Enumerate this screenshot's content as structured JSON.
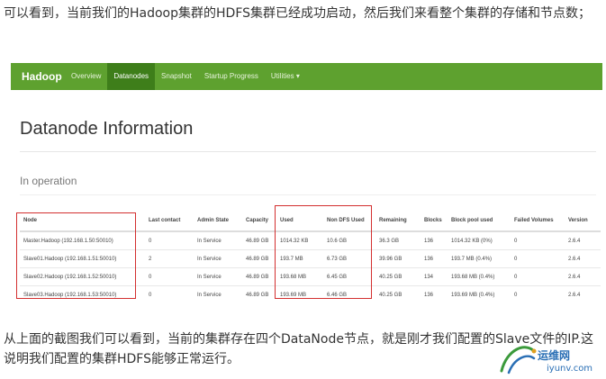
{
  "article": {
    "para1": "可以看到，当前我们的Hadoop集群的HDFS集群已经成功启动，然后我们来看整个集群的存储和节点数；",
    "para2": "从上面的截图我们可以看到，当前的集群存在四个DataNode节点，就是刚才我们配置的Slave文件的IP.这说明我们配置的集群HDFS能够正常运行。"
  },
  "navbar": {
    "brand": "Hadoop",
    "items": [
      {
        "label": "Overview"
      },
      {
        "label": "Datanodes",
        "active": true
      },
      {
        "label": "Snapshot"
      },
      {
        "label": "Startup Progress"
      },
      {
        "label": "Utilities ▾"
      }
    ],
    "bg_color": "#5ea12f",
    "active_color": "#3e7e1a"
  },
  "page": {
    "title": "Datanode Information",
    "subtitle": "In operation"
  },
  "table": {
    "headers": [
      "Node",
      "Last contact",
      "Admin State",
      "Capacity",
      "Used",
      "Non DFS Used",
      "Remaining",
      "Blocks",
      "Block pool used",
      "Failed Volumes",
      "Version"
    ],
    "rows": [
      [
        "Master.Hadoop (192.168.1.50:50010)",
        "0",
        "In Service",
        "46.89 GB",
        "1014.32 KB",
        "10.6 GB",
        "36.3 GB",
        "136",
        "1014.32 KB (0%)",
        "0",
        "2.6.4"
      ],
      [
        "Slave01.Hadoop (192.168.1.51:50010)",
        "2",
        "In Service",
        "46.89 GB",
        "193.7 MB",
        "6.73 GB",
        "39.96 GB",
        "136",
        "193.7 MB (0.4%)",
        "0",
        "2.6.4"
      ],
      [
        "Slave02.Hadoop (192.168.1.52:50010)",
        "0",
        "In Service",
        "46.89 GB",
        "193.68 MB",
        "6.45 GB",
        "40.25 GB",
        "134",
        "193.68 MB (0.4%)",
        "0",
        "2.6.4"
      ],
      [
        "Slave03.Hadoop (192.168.1.53:50010)",
        "0",
        "In Service",
        "46.89 GB",
        "193.69 MB",
        "6.46 GB",
        "40.25 GB",
        "136",
        "193.69 MB (0.4%)",
        "0",
        "2.6.4"
      ]
    ]
  },
  "watermark": {
    "name": "运维网",
    "domain": "iyunv.com"
  }
}
